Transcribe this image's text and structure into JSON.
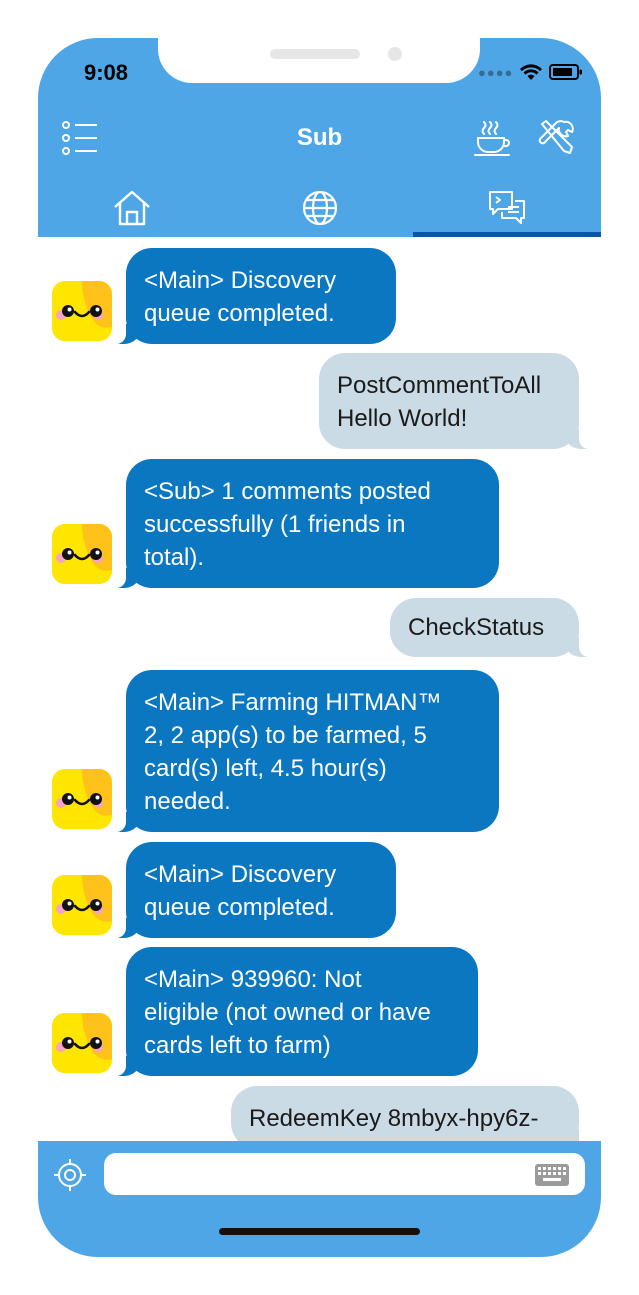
{
  "status_bar": {
    "time": "9:08"
  },
  "header": {
    "title": "Sub"
  },
  "top_icons": [
    "list-icon",
    "coffee-icon",
    "tools-icon"
  ],
  "tabs": [
    {
      "name": "home",
      "icon": "home-icon",
      "active": false
    },
    {
      "name": "globe",
      "icon": "globe-icon",
      "active": false
    },
    {
      "name": "console",
      "icon": "console-chat-icon",
      "active": true
    }
  ],
  "messages": [
    {
      "side": "bot",
      "text": "<Main>    Discovery\nqueue completed."
    },
    {
      "side": "user",
      "text": "PostCommentToAll\nHello World!"
    },
    {
      "side": "bot",
      "text": "<Sub>    1 comments posted\nsuccessfully (1 friends in\ntotal)."
    },
    {
      "side": "user",
      "text": "CheckStatus"
    },
    {
      "side": "bot",
      "text": "<Main>    Farming HITMAN™\n2, 2 app(s) to be farmed, 5\ncard(s) left, 4.5 hour(s)\nneeded."
    },
    {
      "side": "bot",
      "text": "<Main>    Discovery\nqueue completed."
    },
    {
      "side": "bot",
      "text": "<Main>    939960: Not\neligible (not owned or have\ncards left to farm)"
    },
    {
      "side": "user",
      "text": "RedeemKey 8mbyx-hpy6z-"
    }
  ],
  "input": {
    "value": "",
    "placeholder": ""
  },
  "colors": {
    "header": "#4FA6E6",
    "bot_bubble": "#0C77C1",
    "user_bubble": "#CBDBE5",
    "tab_indicator": "#0E55A8"
  }
}
